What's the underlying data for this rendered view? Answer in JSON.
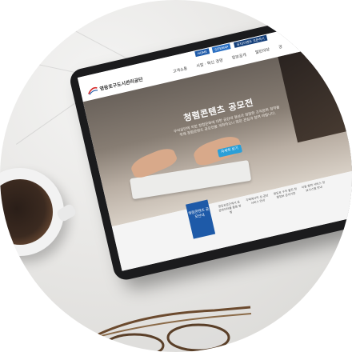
{
  "website": {
    "logo_text": "영등포구도시관리공단",
    "utility": [
      "HOME",
      "SITEMAP",
      "공지/이벤트 오픈하기"
    ],
    "nav": [
      "고객소통",
      "사업 · 혁신 경영",
      "정보공개",
      "열린마당",
      "공"
    ],
    "hero": {
      "title": "청렴콘텐츠 공모전",
      "description": "우리공단에 의한 청렴문화에 대한 공감대 형성과 청렴한 조직문화 정착을 위해 청렴콘텐츠 공모전을 개최하오니 많은 관심과 참여 바랍니다.",
      "button": "자세히 보기"
    },
    "bottom": {
      "notice": "청렴콘텐츠 공모안내",
      "quick": [
        "영등포공단에서 공공데이터를 활용 방법",
        "주택에서의 심 공단 서비스 안내",
        "영등포 구의 발전 청렴정보 공개기준",
        "이용 협력 서비스 정보시스템 안내"
      ]
    }
  },
  "colors": {
    "brand_blue": "#1e5aa8",
    "button_blue": "#2a9fd8",
    "tablet_bezel": "#1b1b1d",
    "marble": "#e8e7e5"
  }
}
